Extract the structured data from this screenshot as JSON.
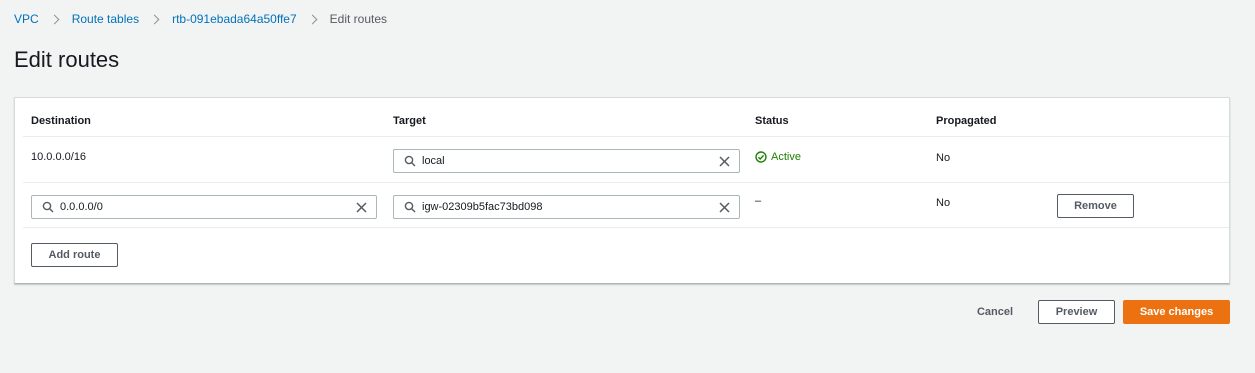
{
  "breadcrumb": {
    "items": [
      "VPC",
      "Route tables",
      "rtb-091ebada64a50ffe7"
    ],
    "current": "Edit routes"
  },
  "page": {
    "title": "Edit routes"
  },
  "table": {
    "headers": {
      "destination": "Destination",
      "target": "Target",
      "status": "Status",
      "propagated": "Propagated"
    },
    "rows": [
      {
        "destination": "10.0.0.0/16",
        "target": "local",
        "status": "Active",
        "propagated": "No"
      },
      {
        "destination": "0.0.0.0/0",
        "target": "igw-02309b5fac73bd098",
        "status": "–",
        "propagated": "No",
        "action": "Remove"
      }
    ],
    "add_route_label": "Add route"
  },
  "footer": {
    "cancel_label": "Cancel",
    "preview_label": "Preview",
    "save_label": "Save changes"
  },
  "icons": {
    "search": "search-icon",
    "clear": "close-icon",
    "status": "check-circle-icon",
    "separator": "chevron-right-icon"
  },
  "colors": {
    "link": "#0073bb",
    "primary": "#ec7211",
    "success": "#1d8102"
  }
}
